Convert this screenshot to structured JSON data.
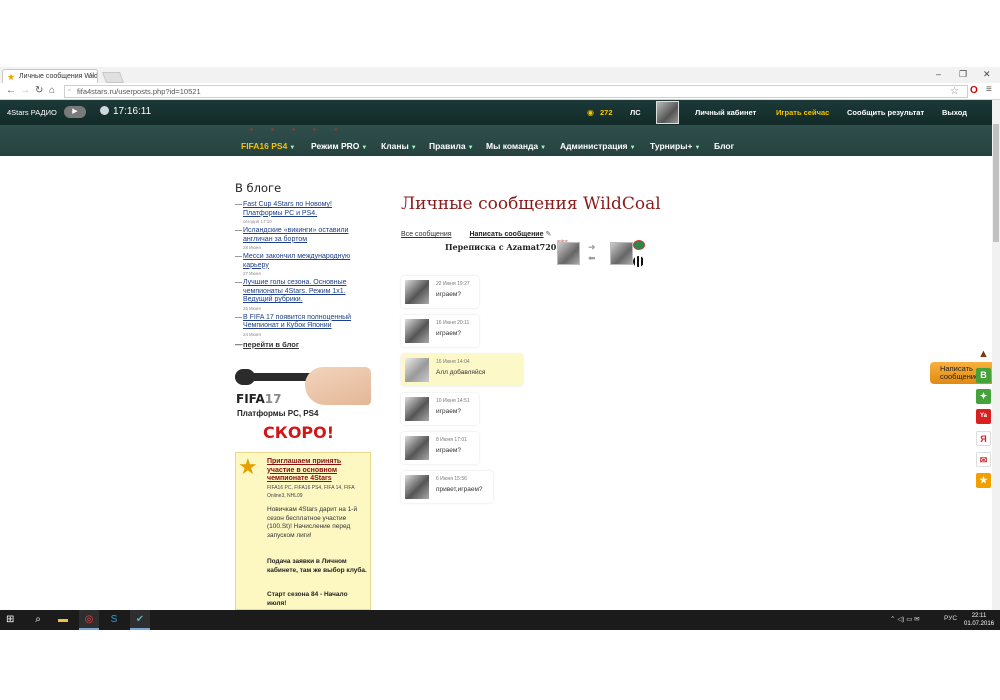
{
  "browser": {
    "tab_title": "Личные сообщения Wild",
    "url": "fifa4stars.ru/userposts.php?id=10521"
  },
  "header": {
    "radio_label": "4Stars РАДИО",
    "clock": "17:16:11",
    "coins": "272",
    "messages_label": "ЛС",
    "links": [
      "Личный кабинет",
      "Играть сейчас",
      "Сообщить результат",
      "Выход"
    ]
  },
  "nav": {
    "items": [
      "FIFA16 PS4",
      "Режим PRO",
      "Кланы",
      "Правила",
      "Мы команда",
      "Администрация",
      "Турниры+",
      "Блог"
    ]
  },
  "sidebar": {
    "blog_title": "В блоге",
    "posts": [
      {
        "title": "Fast Cup 4Stars по Новому! Платформы PC и PS4.",
        "date": "сегодня 17:10"
      },
      {
        "title": "Исландские «викинги» оставили англичан за бортом",
        "date": "28 Июня"
      },
      {
        "title": "Месси закончил международную карьеру",
        "date": "27 Июня"
      },
      {
        "title": "Лучшие голы сезона. Основные чемпионаты 4Stars. Режим 1х1. Ведущий рубрики.",
        "date": "25 Июня"
      },
      {
        "title": "В FIFA 17 появится полноценный Чемпионат и Кубок Японии",
        "date": "24 Июня"
      }
    ],
    "blog_more": "перейти в блог",
    "promo": {
      "fifa": "FIFA",
      "fifa_num": "17",
      "platforms": "Платформы PC, PS4",
      "soon": "СКОРО!"
    },
    "invite": {
      "headline": "Приглашаем принять участие в основном чемпионате 4Stars",
      "platforms": "FIFA16 PC, FIFA16 PS4, FIFA 14, FIFA Online3, NHL09",
      "text1": "Новичкам 4Stars дарит на 1-й сезон бесплатное участие (100.St)! Начисление перед запуском лиги!",
      "text2": "Подача заявки в Личном кабинете, там же выбор клуба.",
      "text3": "Старт сезона 84 - Начало июля!"
    }
  },
  "main": {
    "title": "Личные сообщения WildCoal",
    "all_messages": "Все сообщения",
    "write_message": "Написать сообщение",
    "correspondence": "Переписка с Azamat720",
    "online_label": "online",
    "messages": [
      {
        "date": "22 Июня 19:27",
        "text": "играем?"
      },
      {
        "date": "16 Июня 20:11",
        "text": "играем?"
      },
      {
        "date": "16 Июня 14:04",
        "text": "Алл добавляйся"
      },
      {
        "date": "10 Июня 14:51",
        "text": "играем?"
      },
      {
        "date": "8 Июня 17:01",
        "text": "играем?"
      },
      {
        "date": "6 Июня 15:56",
        "text": "привет,играем?"
      }
    ]
  },
  "right_bar": {
    "feedback": "Написать сообщение",
    "social": [
      "В",
      "Ya",
      "Я"
    ]
  },
  "taskbar": {
    "lang": "РУС",
    "time": "22:11",
    "date": "01.07.2016"
  },
  "colors": {
    "header_bg": "#1c3a38",
    "nav_active": "#f5c400",
    "title_red": "#8a1a1a",
    "highlight_msg": "#fdf8c8"
  }
}
